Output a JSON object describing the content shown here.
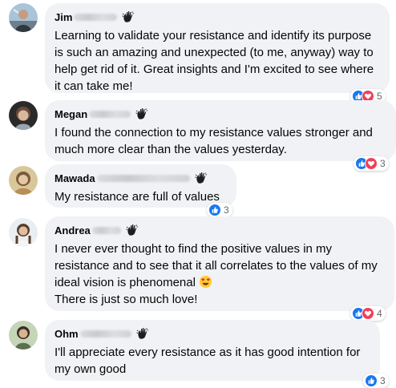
{
  "comments": [
    {
      "name": "Jim",
      "text": "Learning to validate your resistance and identify its purpose is such an amazing and unexpected (to me, anyway) way to help get rid of it. Great insights and I'm excited to see where it can take me!",
      "reaction_count": "5",
      "reactions": [
        "like-icon",
        "love-icon"
      ]
    },
    {
      "name": "Megan",
      "text": "I found the connection to my resistance values stronger and much more clear than the values yesterday.",
      "reaction_count": "3",
      "reactions": [
        "like-icon",
        "love-icon"
      ]
    },
    {
      "name": "Mawada",
      "text": "My resistance are full of values",
      "reaction_count": "3",
      "reactions": [
        "like-icon"
      ]
    },
    {
      "name": "Andrea",
      "text_line1": "I never ever thought to find the positive values in my resistance and to see that it all correlates to the values of my ideal vision is phenomenal",
      "text_line2": "There is just so much love!",
      "reaction_count": "4",
      "reactions": [
        "like-icon",
        "love-icon"
      ]
    },
    {
      "name": "Ohm",
      "text": "I'll appreciate every resistance as it has good intention for my own good",
      "reaction_count": "3",
      "reactions": [
        "like-icon"
      ]
    }
  ],
  "colors": {
    "bubble": "#f0f2f5",
    "like": "#1877f2",
    "love": "#f33e58",
    "text": "#050505",
    "muted": "#65676b"
  }
}
